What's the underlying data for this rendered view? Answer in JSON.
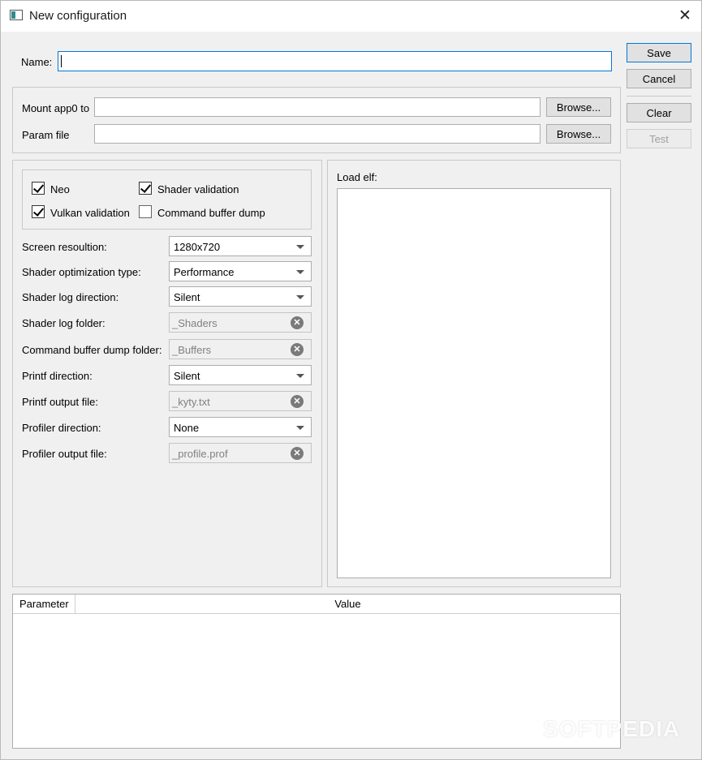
{
  "window": {
    "title": "New configuration"
  },
  "form": {
    "name_label": "Name:",
    "name_value": "",
    "mount_label": "Mount app0 to",
    "mount_value": "",
    "param_label": "Param file",
    "param_value": "",
    "browse_label": "Browse..."
  },
  "side_buttons": {
    "save": "Save",
    "cancel": "Cancel",
    "clear": "Clear",
    "test": "Test"
  },
  "options": {
    "neo": {
      "label": "Neo",
      "checked": true
    },
    "shader_validation": {
      "label": "Shader validation",
      "checked": true
    },
    "vulkan_validation": {
      "label": "Vulkan validation",
      "checked": true
    },
    "command_buffer_dump": {
      "label": "Command buffer dump",
      "checked": false
    }
  },
  "settings": {
    "screen_resolution": {
      "label": "Screen resoultion:",
      "value": "1280x720"
    },
    "shader_opt_type": {
      "label": "Shader optimization type:",
      "value": "Performance"
    },
    "shader_log_direction": {
      "label": "Shader log direction:",
      "value": "Silent"
    },
    "shader_log_folder": {
      "label": "Shader log folder:",
      "value": "_Shaders"
    },
    "cmd_buffer_dump_folder": {
      "label": "Command buffer dump folder:",
      "value": "_Buffers"
    },
    "printf_direction": {
      "label": "Printf direction:",
      "value": "Silent"
    },
    "printf_output_file": {
      "label": "Printf output file:",
      "value": "_kyty.txt"
    },
    "profiler_direction": {
      "label": "Profiler direction:",
      "value": "None"
    },
    "profiler_output_file": {
      "label": "Profiler output file:",
      "value": "_profile.prof"
    }
  },
  "load_elf": {
    "label": "Load elf:"
  },
  "table": {
    "col_parameter": "Parameter",
    "col_value": "Value"
  },
  "watermark": "SOFTPEDIA"
}
